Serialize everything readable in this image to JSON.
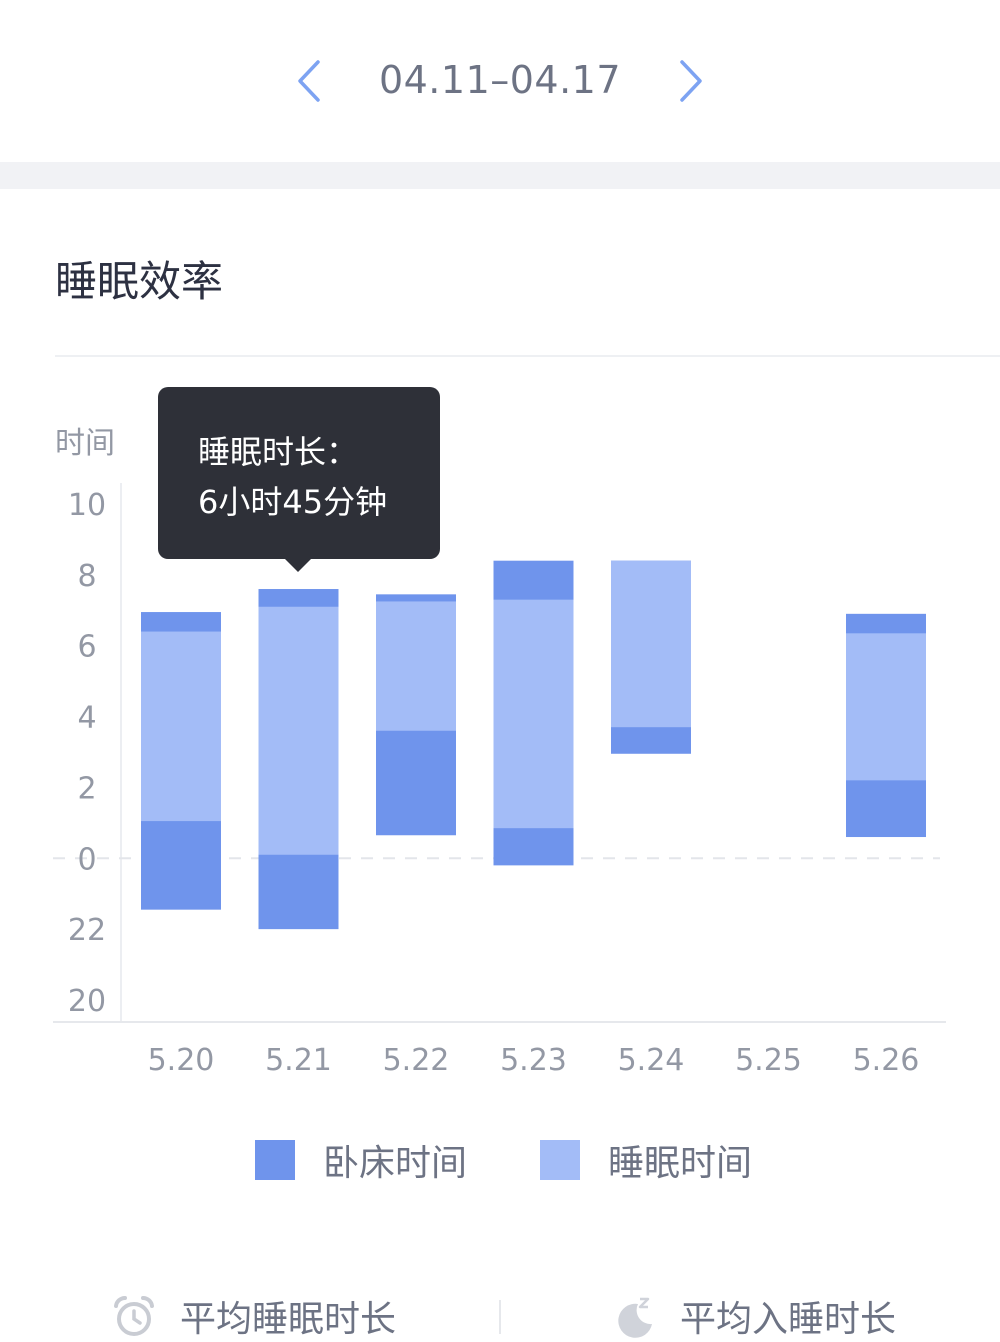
{
  "date_nav": {
    "range": "04.11–04.17",
    "prev_icon": "chevron-left-icon",
    "next_icon": "chevron-right-icon",
    "accent": "#7da3f2"
  },
  "section": {
    "title": "睡眠效率"
  },
  "chart_data": {
    "type": "bar",
    "subtype": "floating-stacked",
    "ylabel": "时间",
    "y_ticks": [
      "20",
      "22",
      "0",
      "2",
      "4",
      "6",
      "8",
      "10"
    ],
    "ylim": [
      20,
      34
    ],
    "categories": [
      "5.20",
      "5.21",
      "5.22",
      "5.23",
      "5.24",
      "5.25",
      "5.26"
    ],
    "series": [
      {
        "name": "卧床时间",
        "color": "#6f94ec",
        "values": [
          [
            22.55,
            30.95
          ],
          [
            22.0,
            31.6
          ],
          [
            24.65,
            31.45
          ],
          [
            23.8,
            32.4
          ],
          [
            26.95,
            32.4
          ],
          null,
          [
            24.6,
            30.9
          ]
        ]
      },
      {
        "name": "睡眠时间",
        "color": "#a3bcf7",
        "values": [
          [
            25.05,
            30.4
          ],
          [
            24.1,
            31.1
          ],
          [
            27.6,
            31.25
          ],
          [
            24.85,
            31.3
          ],
          [
            27.7,
            32.4
          ],
          null,
          [
            26.2,
            30.35
          ]
        ]
      }
    ],
    "baseline": 24,
    "grid": "dashed line at 0",
    "tooltip": {
      "category": "5.21",
      "line1": "睡眠时长：",
      "line2": "6小时45分钟"
    }
  },
  "legend": {
    "items": [
      {
        "label": "卧床时间",
        "color": "#6f94ec"
      },
      {
        "label": "睡眠时间",
        "color": "#a3bcf7"
      }
    ]
  },
  "stats": {
    "left": {
      "label": "平均睡眠时长",
      "icon": "alarm-clock-icon"
    },
    "right": {
      "label": "平均入睡时长",
      "icon": "moon-zz-icon"
    }
  }
}
